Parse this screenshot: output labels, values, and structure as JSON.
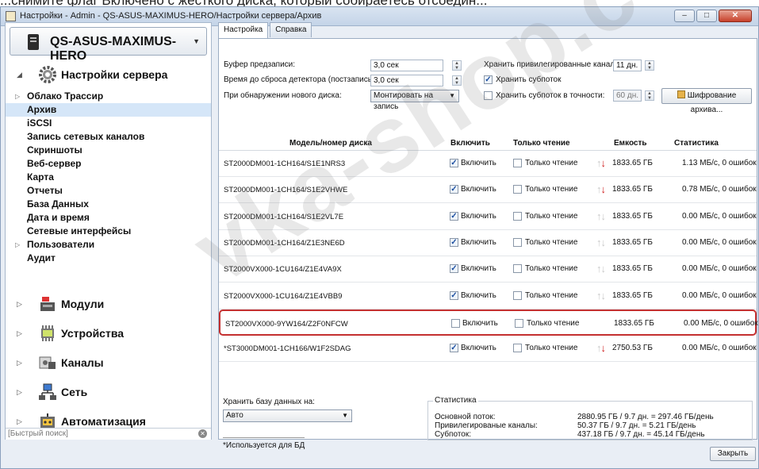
{
  "caption": "...снимите флаг Включено с жесткого диска, который собираетесь отсоедин...",
  "window": {
    "title": "Настройки - Admin - QS-ASUS-MAXIMUS-HERO/Настройки сервера/Архив",
    "buttons": {
      "minimize": "–",
      "maximize": "□",
      "close": "✕"
    }
  },
  "sidebar": {
    "server": "QS-ASUS-MAXIMUS-HERO",
    "settings_section": "Настройки сервера",
    "items": [
      "Облако Трассир",
      "Архив",
      "iSCSI",
      "Запись сетевых каналов",
      "Скриншоты",
      "Веб-сервер",
      "Карта",
      "Отчеты",
      "База Данных",
      "Дата и время",
      "Сетевые интерфейсы",
      "Пользователи",
      "Аудит"
    ],
    "sections": [
      "Модули",
      "Устройства",
      "Каналы",
      "Сеть",
      "Автоматизация"
    ],
    "search_placeholder": "[Быстрый поиск]"
  },
  "tabs": [
    "Настройка",
    "Справка"
  ],
  "form": {
    "prebuffer_label": "Буфер предзаписи:",
    "prebuffer_value": "3,0 сек",
    "detector_label": "Время до сброса детектора (постзапись):",
    "detector_value": "3,0 сек",
    "newdisk_label": "При обнаружении нового диска:",
    "newdisk_value": "Монтировать на запись",
    "keep_priv_label": "Хранить привилегированные каналы:",
    "keep_priv_value": "11 дн.",
    "keep_substreams_label": "Хранить субпоток",
    "keep_substreams_exact_label": "Хранить субпоток в точности:",
    "keep_substreams_exact_value": "60 дн.",
    "encrypt_button": "Шифрование архива..."
  },
  "table": {
    "headers": [
      "Модель/номер диска",
      "Включить",
      "Только чтение",
      "Емкость",
      "Статистика"
    ],
    "enable_label": "Включить",
    "readonly_label": "Только чтение",
    "rows": [
      {
        "model": "ST2000DM001-1CH164/S1E1NRS3",
        "enabled": true,
        "capacity": "1833.65 ГБ",
        "stats": "1.13 МБ/с, 0 ошибок",
        "arrow": "red"
      },
      {
        "model": "ST2000DM001-1CH164/S1E2VHWE",
        "enabled": true,
        "capacity": "1833.65 ГБ",
        "stats": "0.78 МБ/с, 0 ошибок",
        "arrow": "red"
      },
      {
        "model": "ST2000DM001-1CH164/S1E2VL7E",
        "enabled": true,
        "capacity": "1833.65 ГБ",
        "stats": "0.00 МБ/с, 0 ошибок",
        "arrow": "gray"
      },
      {
        "model": "ST2000DM001-1CH164/Z1E3NE6D",
        "enabled": true,
        "capacity": "1833.65 ГБ",
        "stats": "0.00 МБ/с, 0 ошибок",
        "arrow": "gray"
      },
      {
        "model": "ST2000VX000-1CU164/Z1E4VA9X",
        "enabled": true,
        "capacity": "1833.65 ГБ",
        "stats": "0.00 МБ/с, 0 ошибок",
        "arrow": "gray"
      },
      {
        "model": "ST2000VX000-1CU164/Z1E4VBB9",
        "enabled": true,
        "capacity": "1833.65 ГБ",
        "stats": "0.00 МБ/с, 0 ошибок",
        "arrow": "gray"
      },
      {
        "model": "ST2000VX000-9YW164/Z2F0NFCW",
        "enabled": false,
        "capacity": "1833.65 ГБ",
        "stats": "0.00 МБ/с, 0 ошибок",
        "arrow": "none"
      },
      {
        "model": "*ST3000DM001-1CH166/W1F2SDAG",
        "enabled": true,
        "capacity": "2750.53 ГБ",
        "stats": "0.00 МБ/с, 0 ошибок",
        "arrow": "red"
      }
    ]
  },
  "bottom": {
    "store_db_label": "Хранить базу данных на:",
    "store_db_value": "Авто",
    "db_note": "*Используется для БД",
    "stats_legend": "Статистика",
    "stats": [
      {
        "label": "Основной поток:",
        "value": "2880.95 ГБ / 9.7 дн. = 297.46 ГБ/день"
      },
      {
        "label": "Привилегированые каналы:",
        "value": "50.37 ГБ / 9.7 дн. = 5.21 ГБ/день"
      },
      {
        "label": "Субпоток:",
        "value": "437.18 ГБ / 9.7 дн. = 45.14 ГБ/день"
      }
    ]
  },
  "close_button": "Закрыть",
  "watermark": "vka-shop.c"
}
